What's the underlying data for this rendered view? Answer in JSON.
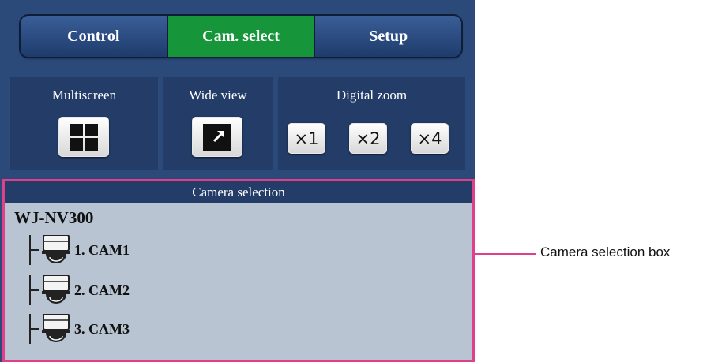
{
  "tabs": [
    {
      "label": "Control",
      "active": false
    },
    {
      "label": "Cam. select",
      "active": true
    },
    {
      "label": "Setup",
      "active": false
    }
  ],
  "groups": {
    "multiscreen": {
      "title": "Multiscreen",
      "icon": "quad-grid-icon"
    },
    "wide_view": {
      "title": "Wide view",
      "icon": "expand-arrow-icon"
    },
    "digital_zoom": {
      "title": "Digital zoom",
      "buttons": [
        "×1",
        "×2",
        "×4"
      ]
    }
  },
  "camera_selection": {
    "header": "Camera selection",
    "root": "WJ-NV300",
    "cameras": [
      {
        "label": "1. CAM1",
        "icon": "dome-camera-icon"
      },
      {
        "label": "2. CAM2",
        "icon": "dome-camera-icon"
      },
      {
        "label": "3. CAM3",
        "icon": "dome-camera-icon"
      }
    ]
  },
  "callout": {
    "label": "Camera selection box"
  },
  "colors": {
    "panel": "#2b4a7a",
    "active_tab": "#17953a",
    "highlight": "#e0408a",
    "list_bg": "#b8c4d2"
  }
}
